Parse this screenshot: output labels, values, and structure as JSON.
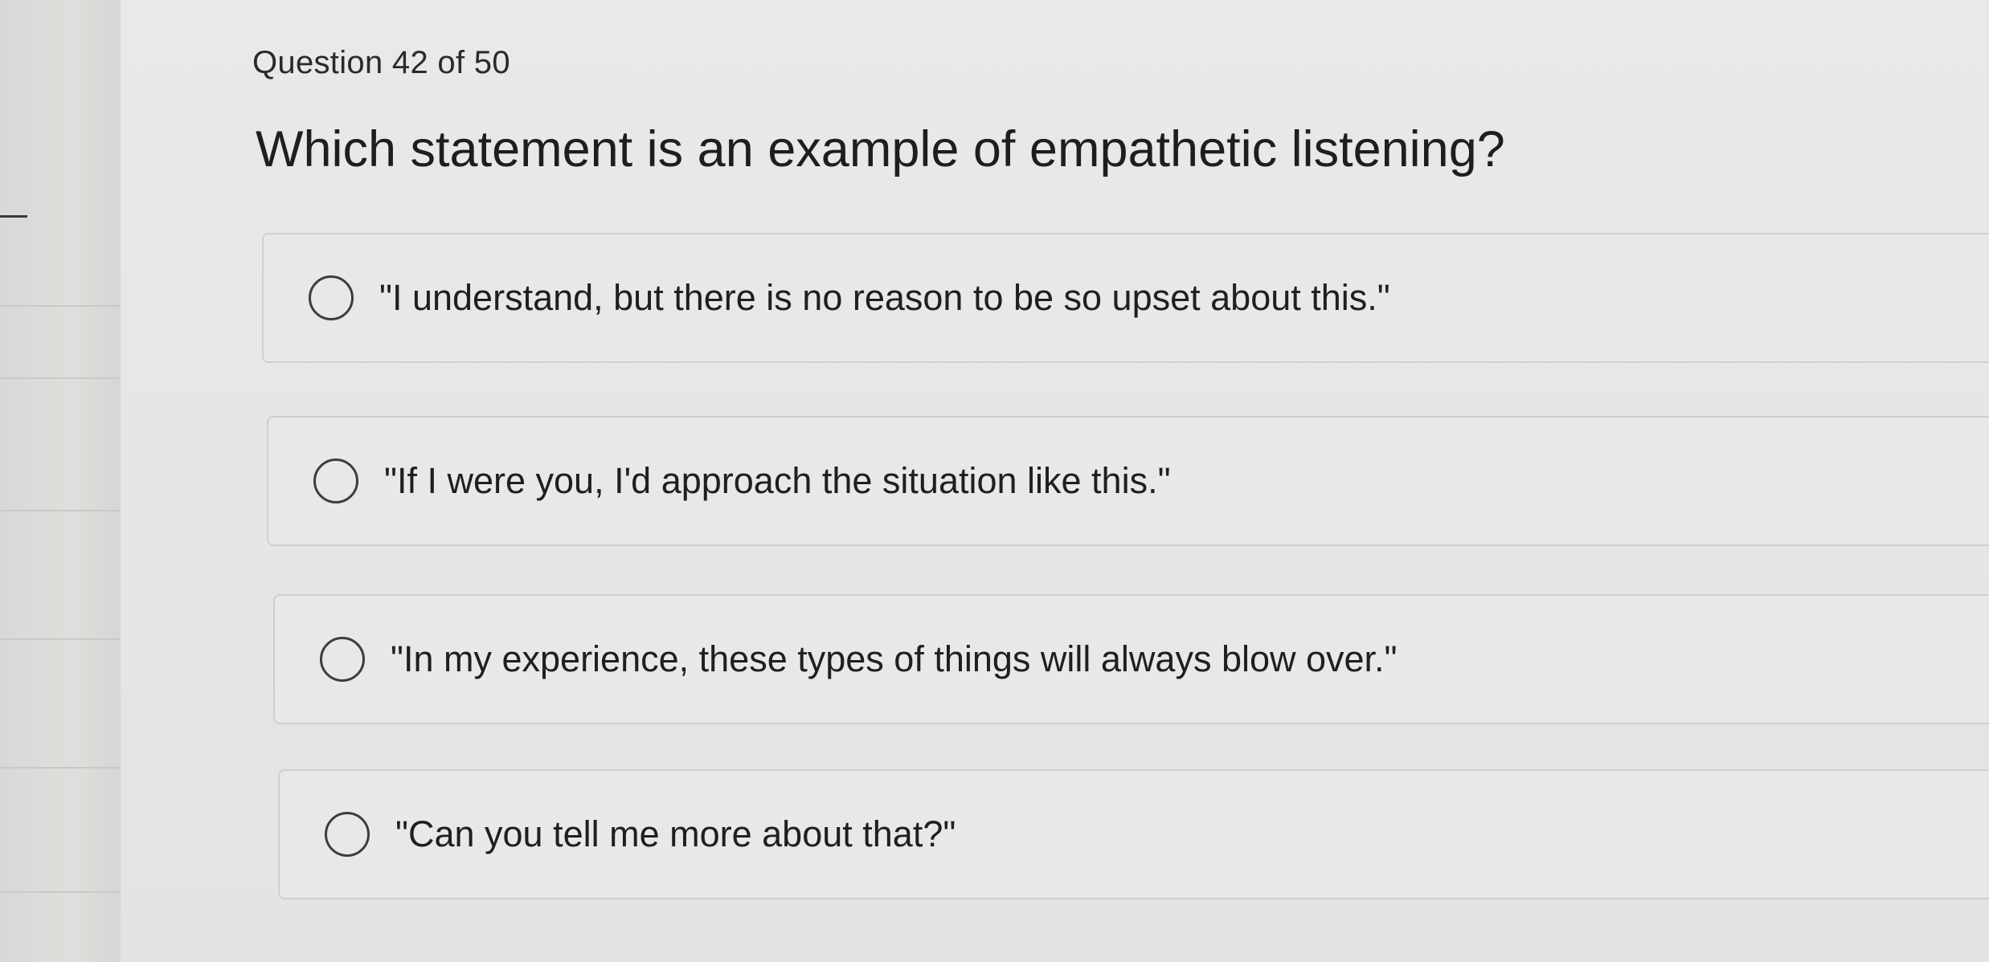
{
  "question": {
    "counter": "Question 42 of 50",
    "prompt": "Which statement is an example of empathetic listening?"
  },
  "options": [
    {
      "label": "\"I understand, but there is no reason to be so upset about this.\"",
      "selected": false
    },
    {
      "label": "\"If I were you, I'd approach the situation like this.\"",
      "selected": false
    },
    {
      "label": "\"In my experience, these types of things will always blow over.\"",
      "selected": false
    },
    {
      "label": "\"Can you tell me more about that?\"",
      "selected": false
    }
  ]
}
